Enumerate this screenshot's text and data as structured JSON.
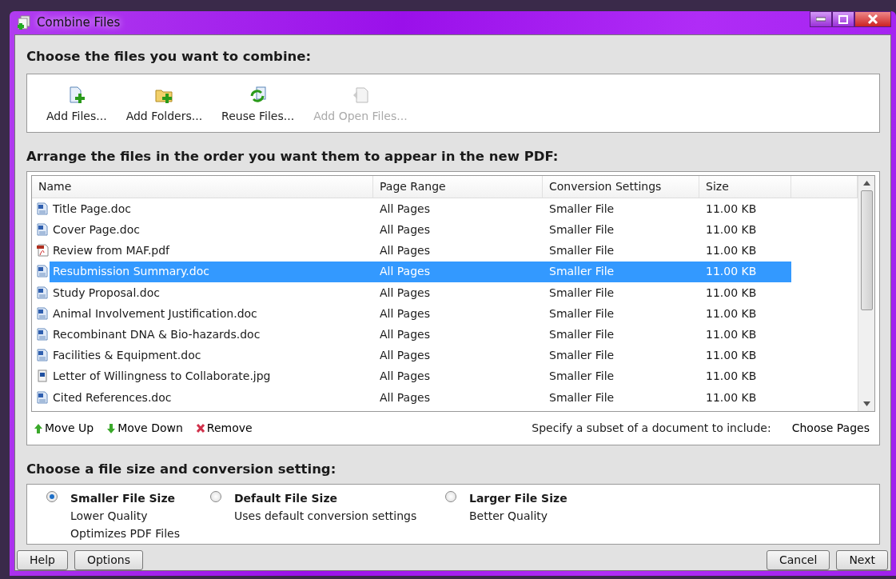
{
  "window": {
    "title": "Combine Files"
  },
  "choose_heading": "Choose the files you want to combine:",
  "toolbar": [
    {
      "kind": "add-file",
      "label": "Add Files...",
      "disabled": false
    },
    {
      "kind": "add-folder",
      "label": "Add Folders...",
      "disabled": false
    },
    {
      "kind": "reuse",
      "label": "Reuse Files...",
      "disabled": false
    },
    {
      "kind": "open-files",
      "label": "Add Open Files...",
      "disabled": true
    }
  ],
  "arrange_heading": "Arrange the files in the order you want them to appear in the new PDF:",
  "table": {
    "columns": [
      "Name",
      "Page Range",
      "Conversion Settings",
      "Size"
    ],
    "rows": [
      {
        "kind": "doc",
        "name": "Title Page.doc",
        "page_range": "All Pages",
        "conversion": "Smaller File",
        "size": "11.00 KB",
        "selected": false
      },
      {
        "kind": "doc",
        "name": "Cover Page.doc",
        "page_range": "All Pages",
        "conversion": "Smaller File",
        "size": "11.00 KB",
        "selected": false
      },
      {
        "kind": "pdf",
        "name": "Review from MAF.pdf",
        "page_range": "All Pages",
        "conversion": "Smaller File",
        "size": "11.00 KB",
        "selected": false
      },
      {
        "kind": "doc",
        "name": "Resubmission Summary.doc",
        "page_range": "All Pages",
        "conversion": "Smaller File",
        "size": "11.00 KB",
        "selected": true
      },
      {
        "kind": "doc",
        "name": "Study Proposal.doc",
        "page_range": "All Pages",
        "conversion": "Smaller File",
        "size": "11.00 KB",
        "selected": false
      },
      {
        "kind": "doc",
        "name": "Animal Involvement Justification.doc",
        "page_range": "All Pages",
        "conversion": "Smaller File",
        "size": "11.00 KB",
        "selected": false
      },
      {
        "kind": "doc",
        "name": "Recombinant DNA & Bio-hazards.doc",
        "page_range": "All Pages",
        "conversion": "Smaller File",
        "size": "11.00 KB",
        "selected": false
      },
      {
        "kind": "doc",
        "name": "Facilities & Equipment.doc",
        "page_range": "All Pages",
        "conversion": "Smaller File",
        "size": "11.00 KB",
        "selected": false
      },
      {
        "kind": "jpg",
        "name": "Letter of Willingness to Collaborate.jpg",
        "page_range": "All Pages",
        "conversion": "Smaller File",
        "size": "11.00 KB",
        "selected": false
      },
      {
        "kind": "doc",
        "name": "Cited References.doc",
        "page_range": "All Pages",
        "conversion": "Smaller File",
        "size": "11.00 KB",
        "selected": false
      }
    ]
  },
  "list_actions": [
    {
      "kind": "up",
      "label": "Move Up"
    },
    {
      "kind": "down",
      "label": "Move Down"
    },
    {
      "kind": "remove",
      "label": "Remove"
    }
  ],
  "subset_hint": "Specify a subset of a document to include:",
  "choose_pages": "Choose Pages",
  "size_heading": "Choose a file size and conversion setting:",
  "size_options": [
    {
      "title": "Smaller File Size",
      "lines": [
        "Lower Quality",
        "Optimizes PDF Files"
      ],
      "selected": true
    },
    {
      "title": "Default File Size",
      "lines": [
        "Uses default conversion settings"
      ],
      "selected": false
    },
    {
      "title": "Larger File Size",
      "lines": [
        "Better Quality"
      ],
      "selected": false
    }
  ],
  "buttons_left": [
    "Help",
    "Options"
  ],
  "buttons_right": [
    "Cancel",
    "Next"
  ]
}
